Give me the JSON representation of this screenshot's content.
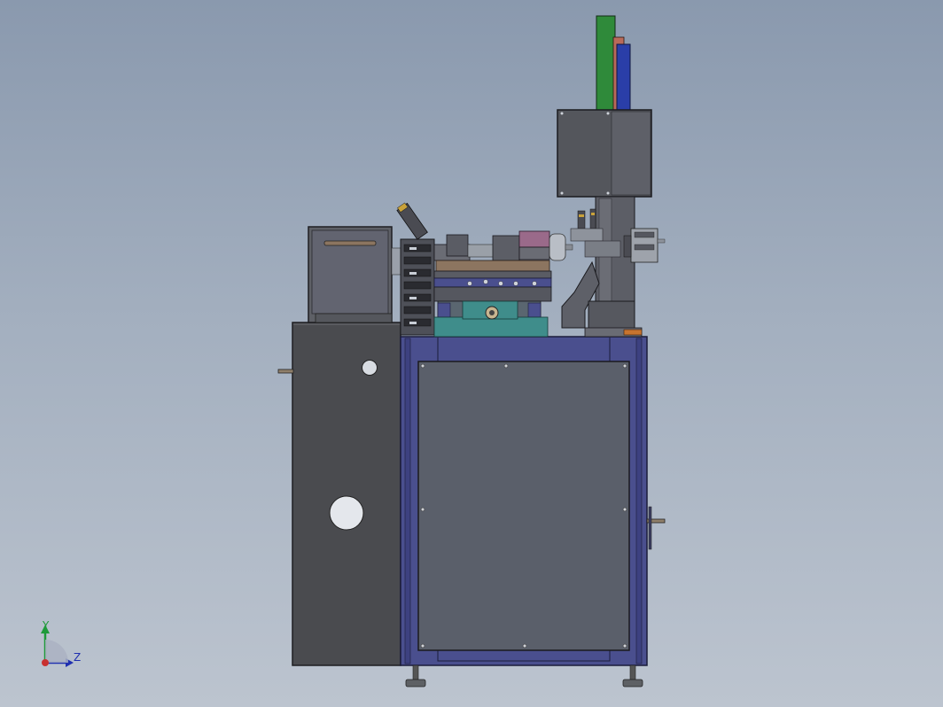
{
  "colors": {
    "background_top": "#8a99ae",
    "background_bottom": "#bcc4cf",
    "frame_blue": "#4a4f8e",
    "panel_gray": "#5a5f6a",
    "cabinet_dark": "#4a4b4f",
    "housing_gray": "#5e6066",
    "teal_base": "#3f8d8b",
    "green_cylinder": "#2f8a3a",
    "blue_cylinder": "#2a3ea8",
    "purple_block": "#9a6a8a",
    "tan_plate": "#8c7560",
    "orange_block": "#c8742f"
  },
  "triad": {
    "y_label": "Y",
    "z_label": "Z"
  }
}
